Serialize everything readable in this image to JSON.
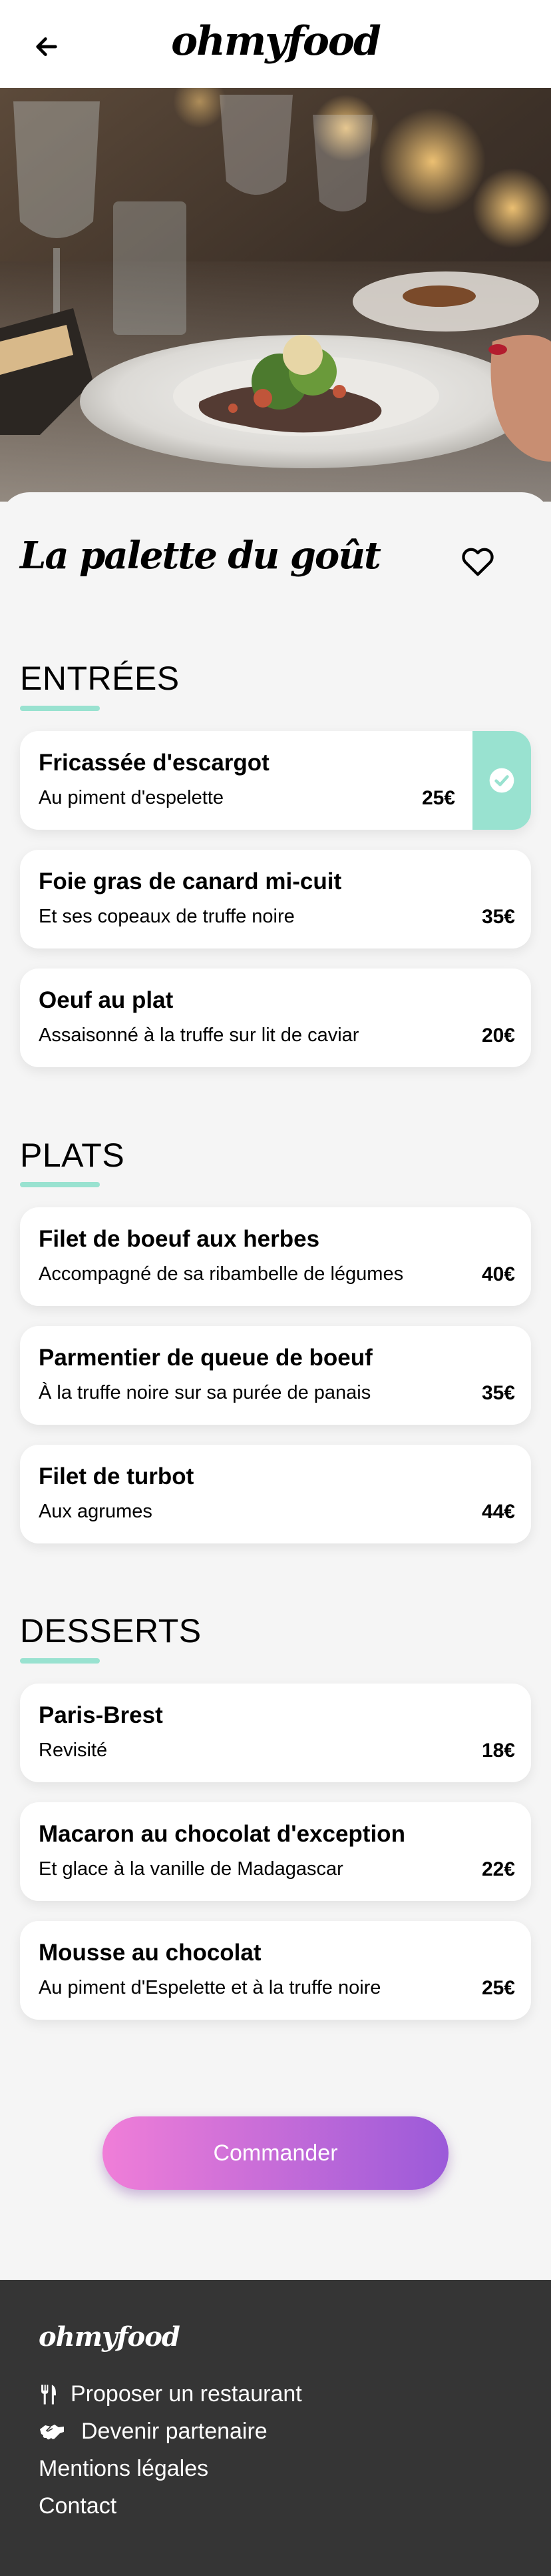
{
  "header": {
    "logo": "ohmyfood",
    "back_icon": "arrow-left-icon"
  },
  "restaurant": {
    "name": "La palette du goût",
    "favorite_icon": "heart-outline-icon"
  },
  "colors": {
    "accent": "#99e2d0",
    "button_start": "#f07ed8",
    "button_end": "#9b5ad9",
    "footer_bg": "#353535",
    "background": "#f5f5f5"
  },
  "sections": [
    {
      "title": "ENTRÉES",
      "items": [
        {
          "name": "Fricassée d'escargot",
          "desc": "Au piment d'espelette",
          "price": "25€",
          "selected": true
        },
        {
          "name": "Foie gras de canard mi-cuit",
          "desc": "Et ses copeaux de truffe noire",
          "price": "35€"
        },
        {
          "name": "Oeuf au plat",
          "desc": "Assaisonné à la truffe sur lit de caviar",
          "price": "20€"
        }
      ]
    },
    {
      "title": "PLATS",
      "items": [
        {
          "name": "Filet de boeuf aux herbes",
          "desc": "Accompagné de sa ribambelle de légumes",
          "price": "40€"
        },
        {
          "name": "Parmentier de queue de boeuf",
          "desc": "À la truffe noire sur sa purée de panais",
          "price": "35€"
        },
        {
          "name": "Filet de turbot",
          "desc": "Aux agrumes",
          "price": "44€"
        }
      ]
    },
    {
      "title": "DESSERTS",
      "items": [
        {
          "name": "Paris-Brest",
          "desc": "Revisité",
          "price": "18€"
        },
        {
          "name": "Macaron au chocolat d'exception",
          "desc": "Et glace à la vanille de Madagascar",
          "price": "22€"
        },
        {
          "name": "Mousse au chocolat",
          "desc": "Au piment d'Espelette et à la truffe noire",
          "price": "25€"
        }
      ]
    }
  ],
  "order_button": {
    "label": "Commander"
  },
  "footer": {
    "logo": "ohmyfood",
    "links": [
      {
        "label": "Proposer un restaurant",
        "icon": "utensils-icon"
      },
      {
        "label": "Devenir partenaire",
        "icon": "handshake-icon"
      },
      {
        "label": "Mentions légales"
      },
      {
        "label": "Contact"
      }
    ]
  }
}
